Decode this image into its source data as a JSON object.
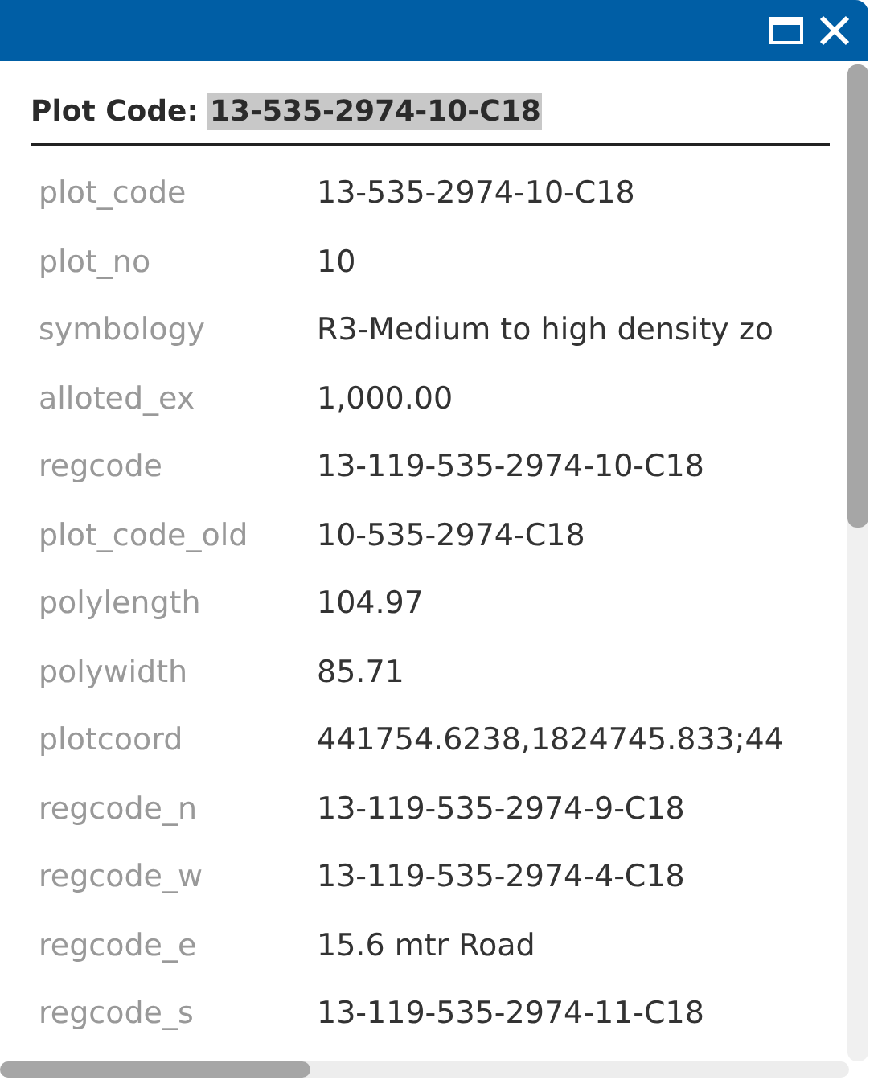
{
  "popup": {
    "title": {
      "label": "Plot Code:",
      "value": "13-535-2974-10-C18",
      "value_selected": true
    }
  },
  "fields": [
    {
      "name": "plot_code",
      "value": "13-535-2974-10-C18"
    },
    {
      "name": "plot_no",
      "value": "10"
    },
    {
      "name": "symbology",
      "value": "R3-Medium to high density zo"
    },
    {
      "name": "alloted_ex",
      "value": "1,000.00"
    },
    {
      "name": "regcode",
      "value": "13-119-535-2974-10-C18"
    },
    {
      "name": "plot_code_old",
      "value": "10-535-2974-C18"
    },
    {
      "name": "polylength",
      "value": "104.97"
    },
    {
      "name": "polywidth",
      "value": "85.71"
    },
    {
      "name": "plotcoord",
      "value": "441754.6238,1824745.833;44"
    },
    {
      "name": "regcode_n",
      "value": "13-119-535-2974-9-C18"
    },
    {
      "name": "regcode_w",
      "value": "13-119-535-2974-4-C18"
    },
    {
      "name": "regcode_e",
      "value": "15.6 mtr Road"
    },
    {
      "name": "regcode_s",
      "value": "13-119-535-2974-11-C18"
    }
  ]
}
